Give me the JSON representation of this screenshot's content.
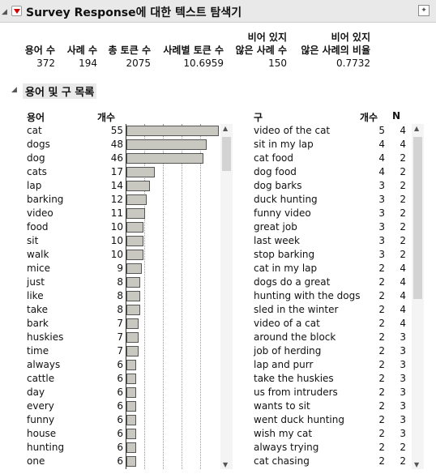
{
  "header": {
    "title": "Survey Response에 대한 텍스트 탐색기"
  },
  "summary": {
    "columns": [
      {
        "head1": "",
        "head2": "용어 수",
        "value": "372"
      },
      {
        "head1": "",
        "head2": "사례 수",
        "value": "194"
      },
      {
        "head1": "",
        "head2": "총 토큰 수",
        "value": "2075"
      },
      {
        "head1": "",
        "head2": "사례별 토큰 수",
        "value": "10.6959"
      },
      {
        "head1": "비어 있지",
        "head2": "않은 사례 수",
        "value": "150"
      },
      {
        "head1": "비어 있지",
        "head2": "않은 사례의 비율",
        "value": "0.7732"
      }
    ]
  },
  "section": {
    "title": "용어 및 구 목록"
  },
  "terms_table": {
    "col_term": "용어",
    "col_count": "개수",
    "max_count": 55,
    "rows": [
      {
        "term": "cat",
        "count": 55
      },
      {
        "term": "dogs",
        "count": 48
      },
      {
        "term": "dog",
        "count": 46
      },
      {
        "term": "cats",
        "count": 17
      },
      {
        "term": "lap",
        "count": 14
      },
      {
        "term": "barking",
        "count": 12
      },
      {
        "term": "video",
        "count": 11
      },
      {
        "term": "food",
        "count": 10
      },
      {
        "term": "sit",
        "count": 10
      },
      {
        "term": "walk",
        "count": 10
      },
      {
        "term": "mice",
        "count": 9
      },
      {
        "term": "just",
        "count": 8
      },
      {
        "term": "like",
        "count": 8
      },
      {
        "term": "take",
        "count": 8
      },
      {
        "term": "bark",
        "count": 7
      },
      {
        "term": "huskies",
        "count": 7
      },
      {
        "term": "time",
        "count": 7
      },
      {
        "term": "always",
        "count": 6
      },
      {
        "term": "cattle",
        "count": 6
      },
      {
        "term": "day",
        "count": 6
      },
      {
        "term": "every",
        "count": 6
      },
      {
        "term": "funny",
        "count": 6
      },
      {
        "term": "house",
        "count": 6
      },
      {
        "term": "hunting",
        "count": 6
      },
      {
        "term": "one",
        "count": 6
      }
    ]
  },
  "phrases_table": {
    "col_phrase": "구",
    "col_count": "개수",
    "col_n": "N",
    "rows": [
      {
        "phrase": "video of the cat",
        "count": 5,
        "n": 4
      },
      {
        "phrase": "sit in my lap",
        "count": 4,
        "n": 4
      },
      {
        "phrase": "cat food",
        "count": 4,
        "n": 2
      },
      {
        "phrase": "dog food",
        "count": 4,
        "n": 2
      },
      {
        "phrase": "dog barks",
        "count": 3,
        "n": 2
      },
      {
        "phrase": "duck hunting",
        "count": 3,
        "n": 2
      },
      {
        "phrase": "funny video",
        "count": 3,
        "n": 2
      },
      {
        "phrase": "great job",
        "count": 3,
        "n": 2
      },
      {
        "phrase": "last week",
        "count": 3,
        "n": 2
      },
      {
        "phrase": "stop barking",
        "count": 3,
        "n": 2
      },
      {
        "phrase": "cat in my lap",
        "count": 2,
        "n": 4
      },
      {
        "phrase": "dogs do a great",
        "count": 2,
        "n": 4
      },
      {
        "phrase": "hunting with the dogs",
        "count": 2,
        "n": 4
      },
      {
        "phrase": "sled in the winter",
        "count": 2,
        "n": 4
      },
      {
        "phrase": "video of a cat",
        "count": 2,
        "n": 4
      },
      {
        "phrase": "around the block",
        "count": 2,
        "n": 3
      },
      {
        "phrase": "job of herding",
        "count": 2,
        "n": 3
      },
      {
        "phrase": "lap and purr",
        "count": 2,
        "n": 3
      },
      {
        "phrase": "take the huskies",
        "count": 2,
        "n": 3
      },
      {
        "phrase": "us from intruders",
        "count": 2,
        "n": 3
      },
      {
        "phrase": "wants to sit",
        "count": 2,
        "n": 3
      },
      {
        "phrase": "went duck hunting",
        "count": 2,
        "n": 3
      },
      {
        "phrase": "wish my cat",
        "count": 2,
        "n": 3
      },
      {
        "phrase": "always trying",
        "count": 2,
        "n": 2
      },
      {
        "phrase": "cat chasing",
        "count": 2,
        "n": 2
      }
    ]
  },
  "colors": {
    "bar_fill": "#c8c8c0",
    "bar_border": "#555555",
    "disclosure_red": "#d00000"
  },
  "icons": {
    "menu": "red-triangle-icon",
    "collapse": "disclosure-triangle-icon",
    "window": "pin-icon"
  }
}
